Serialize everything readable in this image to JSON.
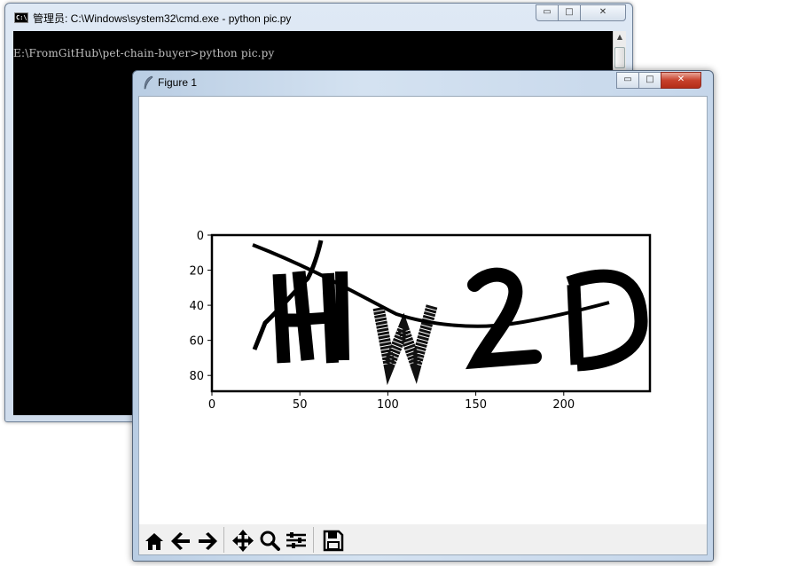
{
  "cmd": {
    "icon_text": "C:\\",
    "title": "管理员: C:\\Windows\\system32\\cmd.exe - python  pic.py",
    "prompt_line": "E:\\FromGitHub\\pet-chain-buyer>python pic.py",
    "minimize_glyph": "▭",
    "maximize_glyph": "□",
    "close_glyph": "✕",
    "scroll_up_glyph": "▲"
  },
  "figure": {
    "title": "Figure 1",
    "minimize_glyph": "▭",
    "maximize_glyph": "□",
    "close_glyph": "✕",
    "toolbar": [
      "home-icon",
      "back-arrow-icon",
      "forward-arrow-icon",
      "pan-icon",
      "zoom-icon",
      "configure-subplots-icon",
      "save-icon"
    ]
  },
  "chart_data": {
    "type": "image",
    "content_text": "HW2D",
    "x_ticks": [
      0,
      50,
      100,
      150,
      200
    ],
    "y_ticks": [
      0,
      20,
      40,
      60,
      80
    ],
    "xlim": [
      0,
      249
    ],
    "ylim": [
      89,
      0
    ],
    "grid": false,
    "colors": {
      "ink": "#000000",
      "background": "#ffffff"
    }
  }
}
